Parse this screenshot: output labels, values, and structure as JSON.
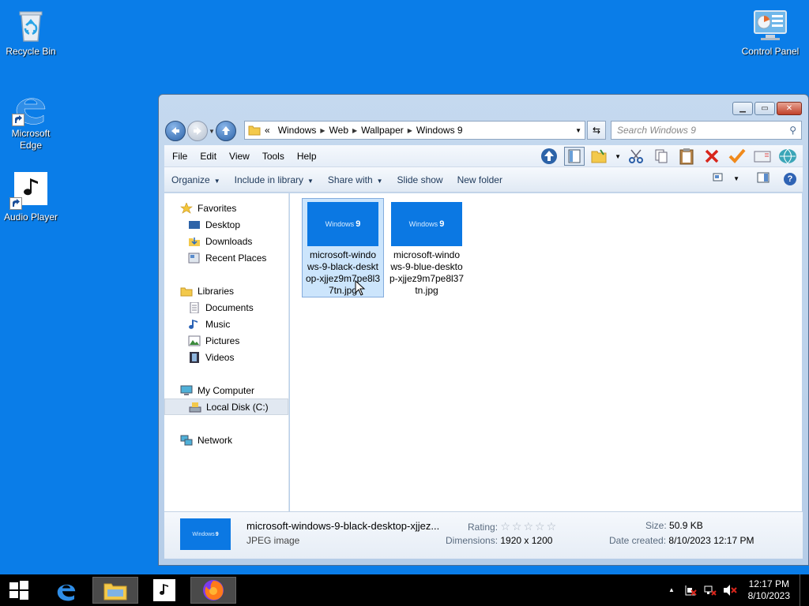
{
  "desktop": {
    "icons": [
      {
        "name": "recycle-bin",
        "label": "Recycle Bin"
      },
      {
        "name": "microsoft-edge",
        "label": "Microsoft Edge"
      },
      {
        "name": "audio-player",
        "label": "Audio Player"
      },
      {
        "name": "control-panel",
        "label": "Control Panel"
      }
    ]
  },
  "window": {
    "title_buttons": {
      "minimize": "▁",
      "maximize": "▭",
      "close": "✕"
    },
    "address": {
      "crumbs": [
        "«",
        "Windows",
        "Web",
        "Wallpaper",
        "Windows 9"
      ]
    },
    "search": {
      "placeholder": "Search Windows 9"
    },
    "menu": [
      "File",
      "Edit",
      "View",
      "Tools",
      "Help"
    ],
    "commands": [
      "Organize",
      "Include in library",
      "Share with",
      "Slide show",
      "New folder"
    ],
    "navpane": {
      "favorites": "Favorites",
      "favorites_items": [
        "Desktop",
        "Downloads",
        "Recent Places"
      ],
      "libraries": "Libraries",
      "libraries_items": [
        "Documents",
        "Music",
        "Pictures",
        "Videos"
      ],
      "computer": "My Computer",
      "computer_items": [
        "Local Disk (C:)"
      ],
      "network": "Network"
    },
    "files": [
      {
        "name": "microsoft-windows-9-black-desktop-xjjez9m7pe8l37tn.jpg",
        "lines": [
          "microsoft-windo",
          "ws-9-black-deskt",
          "op-xjjez9m7pe8l3",
          "7tn.jpg"
        ],
        "selected": true,
        "thumb_text": "Windows",
        "thumb_num": "9"
      },
      {
        "name": "microsoft-windows-9-blue-desktop-xjjez9m7pe8l37tn.jpg",
        "lines": [
          "microsoft-windo",
          "ws-9-blue-deskto",
          "p-xjjez9m7pe8l37",
          "tn.jpg"
        ],
        "selected": false,
        "thumb_text": "Windows",
        "thumb_num": "9"
      }
    ],
    "details": {
      "name": "microsoft-windows-9-black-desktop-xjjez...",
      "type": "JPEG image",
      "rating_label": "Rating:",
      "stars": "☆☆☆☆☆",
      "dimensions_label": "Dimensions:",
      "dimensions": "1920 x 1200",
      "size_label": "Size:",
      "size": "50.9 KB",
      "created_label": "Date created:",
      "created": "8/10/2023 12:17 PM",
      "thumb_text": "Windows",
      "thumb_num": "9"
    }
  },
  "taskbar": {
    "time": "12:17 PM",
    "date": "8/10/2023",
    "tray_arrow": "▲"
  },
  "colors": {
    "desktop": "#0a7de8",
    "thumb": "#0b78e3",
    "selection": "#cce5fc"
  }
}
